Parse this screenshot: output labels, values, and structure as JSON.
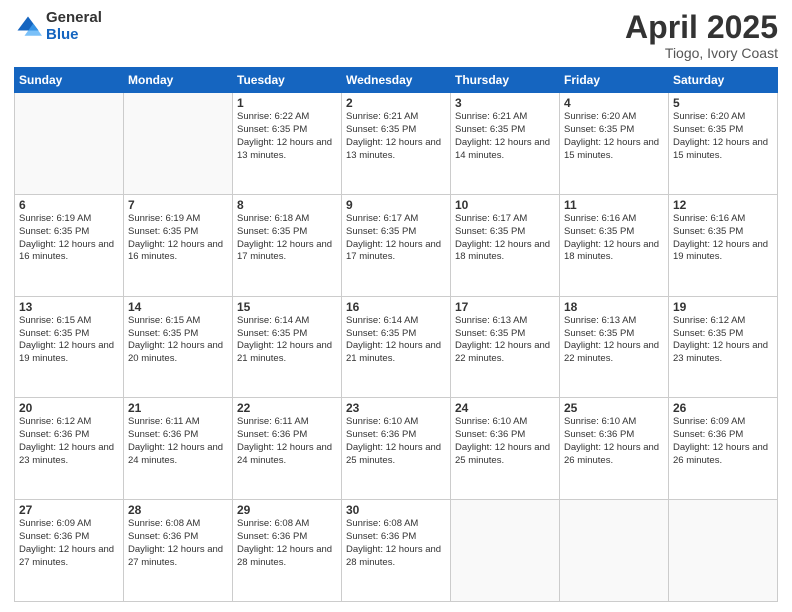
{
  "header": {
    "logo_general": "General",
    "logo_blue": "Blue",
    "title": "April 2025",
    "subtitle": "Tiogo, Ivory Coast"
  },
  "weekdays": [
    "Sunday",
    "Monday",
    "Tuesday",
    "Wednesday",
    "Thursday",
    "Friday",
    "Saturday"
  ],
  "weeks": [
    [
      {
        "day": "",
        "info": ""
      },
      {
        "day": "",
        "info": ""
      },
      {
        "day": "1",
        "info": "Sunrise: 6:22 AM\nSunset: 6:35 PM\nDaylight: 12 hours and 13 minutes."
      },
      {
        "day": "2",
        "info": "Sunrise: 6:21 AM\nSunset: 6:35 PM\nDaylight: 12 hours and 13 minutes."
      },
      {
        "day": "3",
        "info": "Sunrise: 6:21 AM\nSunset: 6:35 PM\nDaylight: 12 hours and 14 minutes."
      },
      {
        "day": "4",
        "info": "Sunrise: 6:20 AM\nSunset: 6:35 PM\nDaylight: 12 hours and 15 minutes."
      },
      {
        "day": "5",
        "info": "Sunrise: 6:20 AM\nSunset: 6:35 PM\nDaylight: 12 hours and 15 minutes."
      }
    ],
    [
      {
        "day": "6",
        "info": "Sunrise: 6:19 AM\nSunset: 6:35 PM\nDaylight: 12 hours and 16 minutes."
      },
      {
        "day": "7",
        "info": "Sunrise: 6:19 AM\nSunset: 6:35 PM\nDaylight: 12 hours and 16 minutes."
      },
      {
        "day": "8",
        "info": "Sunrise: 6:18 AM\nSunset: 6:35 PM\nDaylight: 12 hours and 17 minutes."
      },
      {
        "day": "9",
        "info": "Sunrise: 6:17 AM\nSunset: 6:35 PM\nDaylight: 12 hours and 17 minutes."
      },
      {
        "day": "10",
        "info": "Sunrise: 6:17 AM\nSunset: 6:35 PM\nDaylight: 12 hours and 18 minutes."
      },
      {
        "day": "11",
        "info": "Sunrise: 6:16 AM\nSunset: 6:35 PM\nDaylight: 12 hours and 18 minutes."
      },
      {
        "day": "12",
        "info": "Sunrise: 6:16 AM\nSunset: 6:35 PM\nDaylight: 12 hours and 19 minutes."
      }
    ],
    [
      {
        "day": "13",
        "info": "Sunrise: 6:15 AM\nSunset: 6:35 PM\nDaylight: 12 hours and 19 minutes."
      },
      {
        "day": "14",
        "info": "Sunrise: 6:15 AM\nSunset: 6:35 PM\nDaylight: 12 hours and 20 minutes."
      },
      {
        "day": "15",
        "info": "Sunrise: 6:14 AM\nSunset: 6:35 PM\nDaylight: 12 hours and 21 minutes."
      },
      {
        "day": "16",
        "info": "Sunrise: 6:14 AM\nSunset: 6:35 PM\nDaylight: 12 hours and 21 minutes."
      },
      {
        "day": "17",
        "info": "Sunrise: 6:13 AM\nSunset: 6:35 PM\nDaylight: 12 hours and 22 minutes."
      },
      {
        "day": "18",
        "info": "Sunrise: 6:13 AM\nSunset: 6:35 PM\nDaylight: 12 hours and 22 minutes."
      },
      {
        "day": "19",
        "info": "Sunrise: 6:12 AM\nSunset: 6:35 PM\nDaylight: 12 hours and 23 minutes."
      }
    ],
    [
      {
        "day": "20",
        "info": "Sunrise: 6:12 AM\nSunset: 6:36 PM\nDaylight: 12 hours and 23 minutes."
      },
      {
        "day": "21",
        "info": "Sunrise: 6:11 AM\nSunset: 6:36 PM\nDaylight: 12 hours and 24 minutes."
      },
      {
        "day": "22",
        "info": "Sunrise: 6:11 AM\nSunset: 6:36 PM\nDaylight: 12 hours and 24 minutes."
      },
      {
        "day": "23",
        "info": "Sunrise: 6:10 AM\nSunset: 6:36 PM\nDaylight: 12 hours and 25 minutes."
      },
      {
        "day": "24",
        "info": "Sunrise: 6:10 AM\nSunset: 6:36 PM\nDaylight: 12 hours and 25 minutes."
      },
      {
        "day": "25",
        "info": "Sunrise: 6:10 AM\nSunset: 6:36 PM\nDaylight: 12 hours and 26 minutes."
      },
      {
        "day": "26",
        "info": "Sunrise: 6:09 AM\nSunset: 6:36 PM\nDaylight: 12 hours and 26 minutes."
      }
    ],
    [
      {
        "day": "27",
        "info": "Sunrise: 6:09 AM\nSunset: 6:36 PM\nDaylight: 12 hours and 27 minutes."
      },
      {
        "day": "28",
        "info": "Sunrise: 6:08 AM\nSunset: 6:36 PM\nDaylight: 12 hours and 27 minutes."
      },
      {
        "day": "29",
        "info": "Sunrise: 6:08 AM\nSunset: 6:36 PM\nDaylight: 12 hours and 28 minutes."
      },
      {
        "day": "30",
        "info": "Sunrise: 6:08 AM\nSunset: 6:36 PM\nDaylight: 12 hours and 28 minutes."
      },
      {
        "day": "",
        "info": ""
      },
      {
        "day": "",
        "info": ""
      },
      {
        "day": "",
        "info": ""
      }
    ]
  ]
}
